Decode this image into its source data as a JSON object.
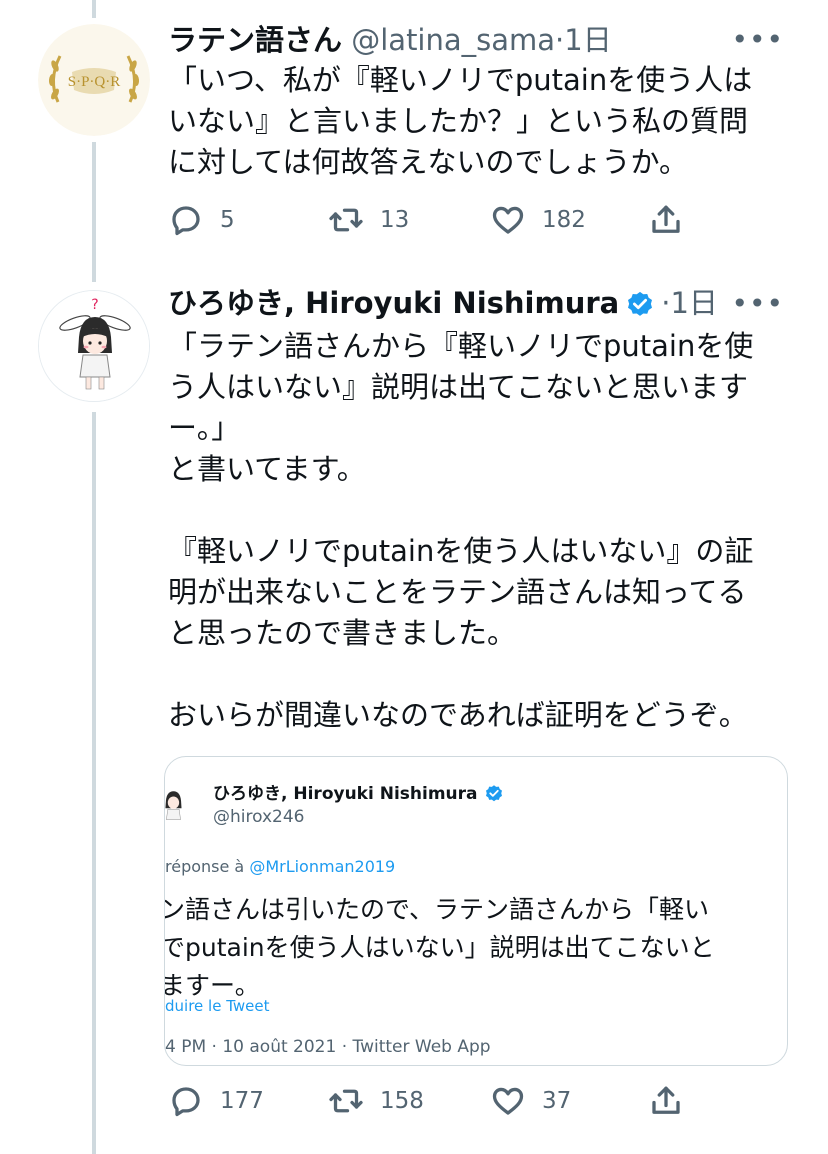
{
  "tweet1": {
    "display_name": "ラテン語さん",
    "handle": "@latina_sama",
    "time_sep": "·",
    "time": "1日",
    "avatar_text": "S·P·Q·R",
    "more": "•••",
    "text": "「いつ、私が『軽いノリでputainを使う人は\nいない』と言いましたか？」という私の質問\nに対しては何故答えないのでしょうか。",
    "replies": "5",
    "retweets": "13",
    "likes": "182"
  },
  "tweet2": {
    "display_name": "ひろゆき, Hiroyuki Nishimura",
    "time_sep": "·",
    "time": "1日",
    "more": "•••",
    "text": "「ラテン語さんから『軽いノリでputainを使\nう人はいない』説明は出てこないと思います\nー。」\nと書いてます。\n\n『軽いノリでputainを使う人はいない』の証\n明が出来ないことをラテン語さんは知ってる\nと思ったので書きました。\n\nおいらが間違いなのであれば証明をどうぞ。",
    "replies": "177",
    "retweets": "158",
    "likes": "37"
  },
  "quoted": {
    "display_name": "ひろゆき, Hiroyuki Nishimura",
    "handle": "@hirox246",
    "reply_prefix": "réponse à ",
    "reply_to": "@MrLionman2019",
    "text": "テン語さんは引いたので、ラテン語さんから「軽い\nリでputainを使う人はいない」説明は出てこないと\nいますー。",
    "translate": "duire le Tweet",
    "meta": "4 PM · 10 août 2021 · Twitter Web App"
  },
  "colors": {
    "text": "#0f1419",
    "secondary": "#536471",
    "link": "#1d9bf0",
    "border": "#cfd9de",
    "gold": "#c9a646"
  }
}
